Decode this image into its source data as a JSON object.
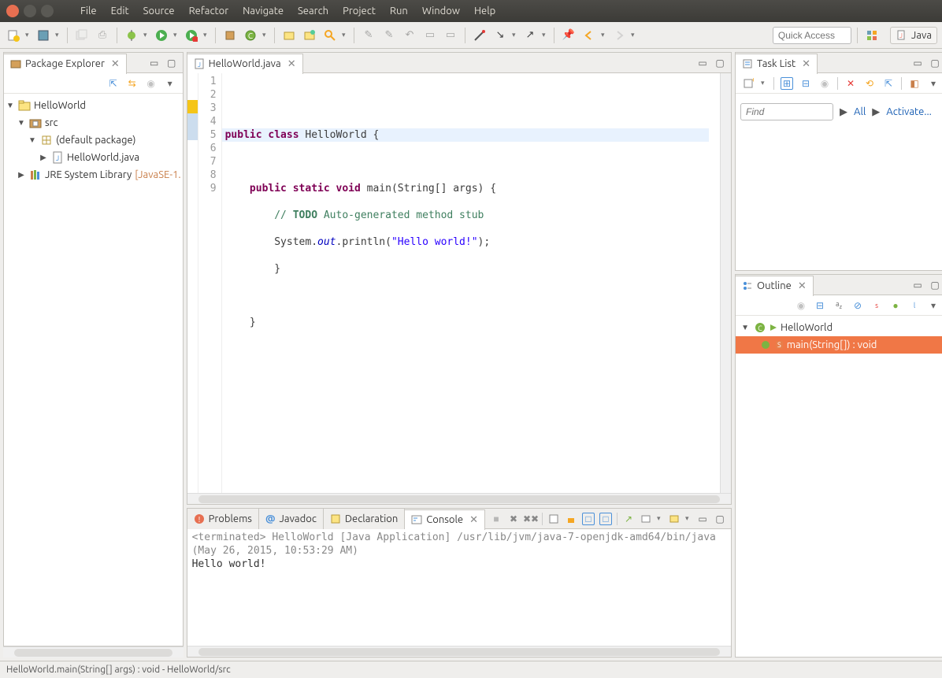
{
  "menubar": [
    "File",
    "Edit",
    "Source",
    "Refactor",
    "Navigate",
    "Search",
    "Project",
    "Run",
    "Window",
    "Help"
  ],
  "quickAccess": {
    "placeholder": "Quick Access"
  },
  "perspective": {
    "label": "Java"
  },
  "packageExplorer": {
    "title": "Package Explorer",
    "tree": [
      {
        "label": "HelloWorld",
        "arrow": "▼",
        "icon": "project",
        "indent": 0
      },
      {
        "label": "src",
        "arrow": "▼",
        "icon": "srcfolder",
        "indent": 1
      },
      {
        "label": "(default package)",
        "arrow": "▼",
        "icon": "package",
        "indent": 2
      },
      {
        "label": "HelloWorld.java",
        "arrow": "▶",
        "icon": "javafile",
        "indent": 3
      },
      {
        "label": "JRE System Library",
        "arrow": "▶",
        "icon": "library",
        "indent": 1,
        "suffix": "[JavaSE-1."
      }
    ]
  },
  "editor": {
    "tabTitle": "HelloWorld.java",
    "lineNumbers": [
      "1",
      "2",
      "3",
      "4",
      "5",
      "6",
      "7",
      "8",
      "9"
    ],
    "highlightLine": 5,
    "code": {
      "l1a": "public",
      "l1b": "class",
      "l1c": " HelloWorld {",
      "l3a": "public",
      "l3b": "static",
      "l3c": "void",
      "l3d": " main(String[] args) {",
      "l4a": "// ",
      "l4b": "TODO",
      "l4c": " Auto-generated method stub",
      "l5a": "System.",
      "l5b": "out",
      "l5c": ".println(",
      "l5d": "\"Hello world!\"",
      "l5e": ");",
      "l6": "        }",
      "l8": "    }"
    }
  },
  "taskList": {
    "title": "Task List",
    "findPlaceholder": "Find",
    "allLink": "All",
    "activateLink": "Activate..."
  },
  "outline": {
    "title": "Outline",
    "rows": [
      {
        "label": "HelloWorld",
        "indent": 0,
        "icon": "class",
        "selected": false
      },
      {
        "label": "main(String[]) : void",
        "indent": 1,
        "icon": "method-s",
        "selected": true
      }
    ]
  },
  "bottom": {
    "tabs": [
      {
        "label": "Problems",
        "active": false
      },
      {
        "label": "Javadoc",
        "active": false
      },
      {
        "label": "Declaration",
        "active": false
      },
      {
        "label": "Console",
        "active": true
      }
    ],
    "consoleHeader": "<terminated> HelloWorld [Java Application] /usr/lib/jvm/java-7-openjdk-amd64/bin/java (May 26, 2015, 10:53:29 AM)",
    "consoleOutput": "Hello world!"
  },
  "statusBar": "HelloWorld.main(String[] args) : void - HelloWorld/src"
}
